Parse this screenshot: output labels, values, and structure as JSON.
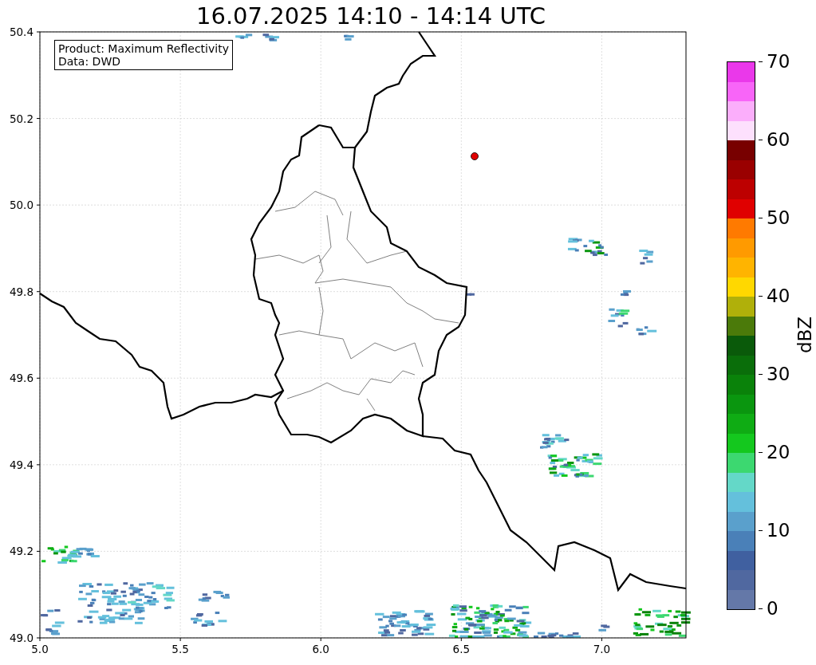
{
  "title": "16.07.2025 14:10 - 14:14 UTC",
  "info_box": [
    "Product: Maximum Reflectivity",
    "Data: DWD"
  ],
  "x_ticks": [
    "5.0",
    "5.5",
    "6.0",
    "6.5",
    "7.0"
  ],
  "y_ticks": [
    "50.4",
    "50.2",
    "50.0",
    "49.8",
    "49.6",
    "49.4",
    "49.2",
    "49.0"
  ],
  "colorbar": {
    "label": "dBZ",
    "ticks": [
      "70",
      "60",
      "50",
      "40",
      "30",
      "20",
      "10",
      "0"
    ],
    "segments": [
      {
        "color": "#ea38ea"
      },
      {
        "color": "#f865f8"
      },
      {
        "color": "#fbaefb"
      },
      {
        "color": "#fde0fd"
      },
      {
        "color": "#780000"
      },
      {
        "color": "#9a0000"
      },
      {
        "color": "#bd0000"
      },
      {
        "color": "#e00000"
      },
      {
        "color": "#ff7a00"
      },
      {
        "color": "#ff9a00"
      },
      {
        "color": "#ffb400"
      },
      {
        "color": "#ffd800"
      },
      {
        "color": "#b0b00a"
      },
      {
        "color": "#4b7a0a"
      },
      {
        "color": "#0a5a0a"
      },
      {
        "color": "#0a6e0a"
      },
      {
        "color": "#0a820a"
      },
      {
        "color": "#0a960f"
      },
      {
        "color": "#0fac14"
      },
      {
        "color": "#14c81e"
      },
      {
        "color": "#3cd870"
      },
      {
        "color": "#64d8c8"
      },
      {
        "color": "#64c0dc"
      },
      {
        "color": "#5aa0cc"
      },
      {
        "color": "#4a80b8"
      },
      {
        "color": "#4060a0"
      },
      {
        "color": "#5068a0"
      },
      {
        "color": "#6478a8"
      }
    ]
  }
}
